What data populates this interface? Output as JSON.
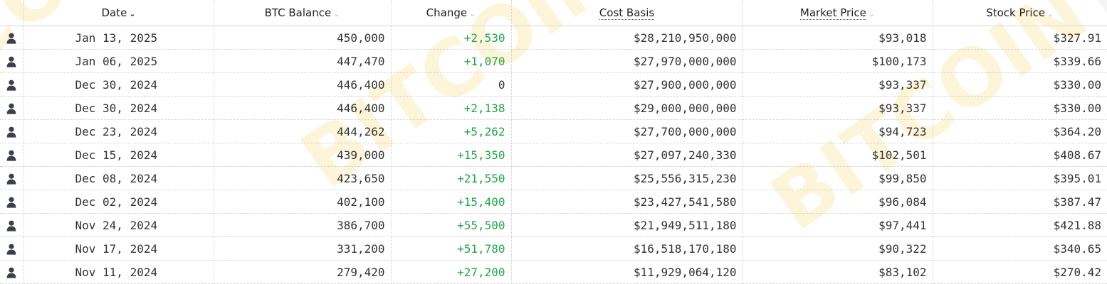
{
  "columns": {
    "date": "Date",
    "btc_balance": "BTC Balance",
    "change": "Change",
    "cost_basis": "Cost Basis",
    "market_price": "Market Price",
    "stock_price": "Stock Price"
  },
  "rows": [
    {
      "date": "Jan 13, 2025",
      "btc_balance": "450,000",
      "change": "+2,530",
      "cost_basis": "$28,210,950,000",
      "market_price": "$93,018",
      "stock_price": "$327.91"
    },
    {
      "date": "Jan 06, 2025",
      "btc_balance": "447,470",
      "change": "+1,070",
      "cost_basis": "$27,970,000,000",
      "market_price": "$100,173",
      "stock_price": "$339.66"
    },
    {
      "date": "Dec 30, 2024",
      "btc_balance": "446,400",
      "change": "0",
      "cost_basis": "$27,900,000,000",
      "market_price": "$93,337",
      "stock_price": "$330.00"
    },
    {
      "date": "Dec 30, 2024",
      "btc_balance": "446,400",
      "change": "+2,138",
      "cost_basis": "$29,000,000,000",
      "market_price": "$93,337",
      "stock_price": "$330.00"
    },
    {
      "date": "Dec 23, 2024",
      "btc_balance": "444,262",
      "change": "+5,262",
      "cost_basis": "$27,700,000,000",
      "market_price": "$94,723",
      "stock_price": "$364.20"
    },
    {
      "date": "Dec 15, 2024",
      "btc_balance": "439,000",
      "change": "+15,350",
      "cost_basis": "$27,097,240,330",
      "market_price": "$102,501",
      "stock_price": "$408.67"
    },
    {
      "date": "Dec 08, 2024",
      "btc_balance": "423,650",
      "change": "+21,550",
      "cost_basis": "$25,556,315,230",
      "market_price": "$99,850",
      "stock_price": "$395.01"
    },
    {
      "date": "Dec 02, 2024",
      "btc_balance": "402,100",
      "change": "+15,400",
      "cost_basis": "$23,427,541,580",
      "market_price": "$96,084",
      "stock_price": "$387.47"
    },
    {
      "date": "Nov 24, 2024",
      "btc_balance": "386,700",
      "change": "+55,500",
      "cost_basis": "$21,949,511,180",
      "market_price": "$97,441",
      "stock_price": "$421.88"
    },
    {
      "date": "Nov 17, 2024",
      "btc_balance": "331,200",
      "change": "+51,780",
      "cost_basis": "$16,518,170,180",
      "market_price": "$90,322",
      "stock_price": "$340.65"
    },
    {
      "date": "Nov 11, 2024",
      "btc_balance": "279,420",
      "change": "+27,200",
      "cost_basis": "$11,929,064,120",
      "market_price": "$83,102",
      "stock_price": "$270.42"
    }
  ],
  "watermark_text": "BITCOINTREASURIES.NET",
  "icons": {
    "row_icon": "person-icon",
    "sort_icon": "chevron-down-icon"
  },
  "colors": {
    "positive_change": "#21a54a",
    "watermark_gray": "#c8c8c8",
    "watermark_yellow": "#f5c518"
  }
}
